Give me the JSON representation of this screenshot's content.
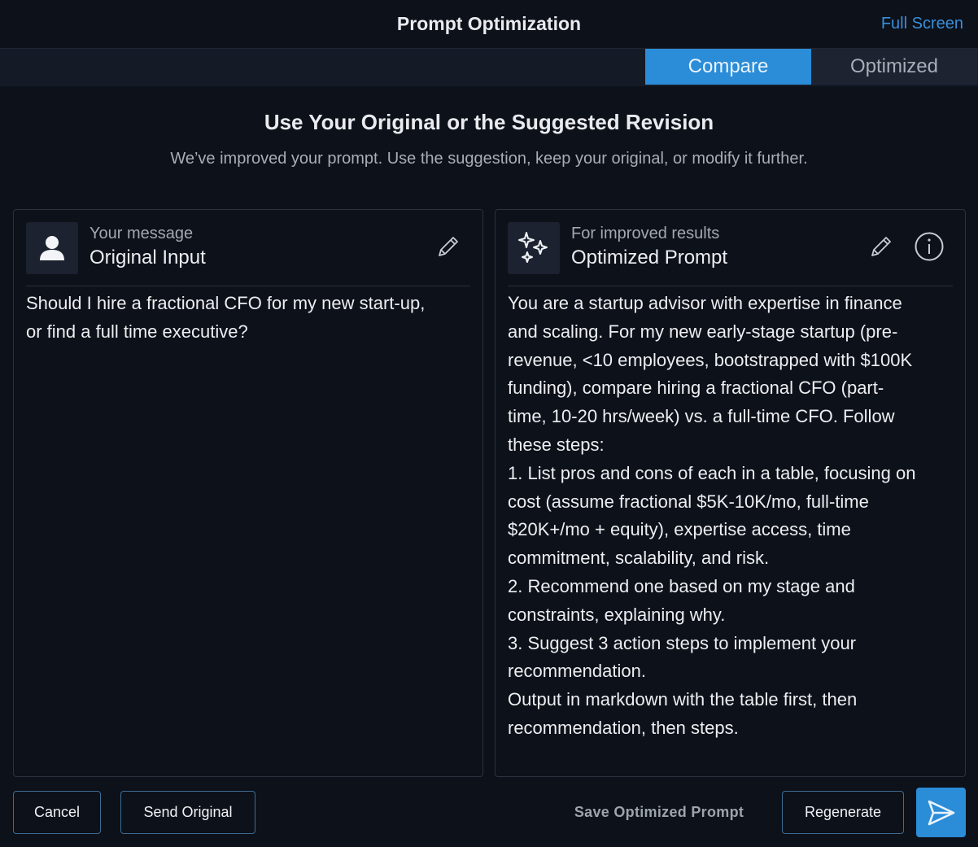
{
  "header": {
    "title": "Prompt Optimization",
    "fullscreen_label": "Full Screen"
  },
  "tabs": [
    {
      "label": "Compare",
      "active": true
    },
    {
      "label": "Optimized",
      "active": false
    }
  ],
  "main": {
    "heading": "Use Your Original or the Suggested Revision",
    "subheading": "We’ve improved your prompt. Use the suggestion, keep your original, or modify it further."
  },
  "original_panel": {
    "icon": "user-icon",
    "subtitle": "Your message",
    "title": "Original Input",
    "text": "Should I hire a fractional CFO for my new start-up,\nor find a full time executive?"
  },
  "optimized_panel": {
    "icon": "sparkles-icon",
    "subtitle": "For improved results",
    "title": "Optimized Prompt",
    "text": "You are a startup advisor with expertise in finance\nand scaling. For my new early-stage startup (pre-\nrevenue, <10 employees, bootstrapped with $100K\nfunding), compare hiring a fractional CFO (part-\ntime, 10-20 hrs/week) vs. a full-time CFO. Follow\nthese steps:\n1. List pros and cons of each in a table, focusing on\ncost (assume fractional $5K-10K/mo, full-time\n$20K+/mo + equity), expertise access, time\ncommitment, scalability, and risk.\n2. Recommend one based on my stage and\nconstraints, explaining why.\n3. Suggest 3 action steps to implement your\nrecommendation.\nOutput in markdown with the table first, then\nrecommendation, then steps."
  },
  "footer": {
    "cancel_label": "Cancel",
    "send_original_label": "Send Original",
    "save_optimized_label": "Save Optimized Prompt",
    "regenerate_label": "Regenerate",
    "send_icon": "send-icon"
  },
  "colors": {
    "accent": "#2b8cd8",
    "link": "#3a8fdb",
    "background": "#0d1119"
  }
}
